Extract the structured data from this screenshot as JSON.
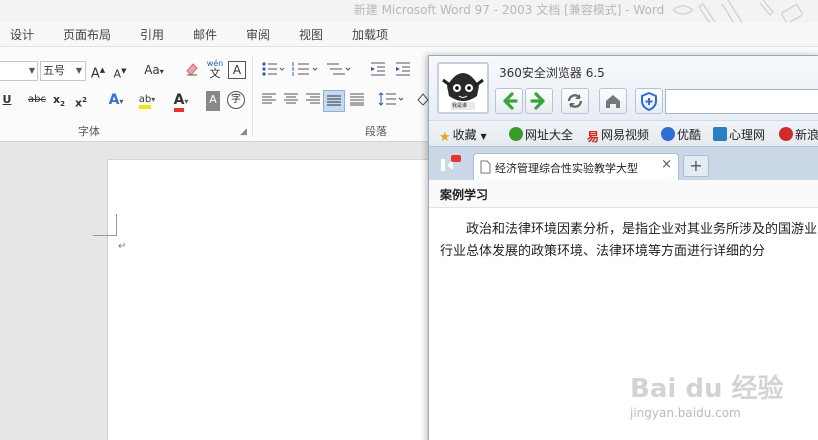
{
  "word": {
    "title": "新建 Microsoft Word 97 - 2003 文档 [兼容模式] - Word",
    "tabs": [
      "设计",
      "页面布局",
      "引用",
      "邮件",
      "审阅",
      "视图",
      "加载项"
    ],
    "font_size": "五号",
    "font_name": "",
    "ribbon_labels": {
      "grow": "A",
      "shrink": "A",
      "change_case": "Aa",
      "phonetic_top": "wén",
      "phonetic_bottom": "文",
      "border_char": "A",
      "strike": "abc",
      "subscript": "x",
      "subscript_small": "2",
      "superscript": "x",
      "superscript_small": "2",
      "underline": "U",
      "text_effect": "A",
      "highlight": "ab",
      "font_color": "A",
      "shade": "A",
      "enclose": "字"
    },
    "groups": {
      "font": "字体",
      "paragraph": "段落"
    },
    "paragraph_mark": "↵"
  },
  "browser": {
    "title": "360安全浏览器 6.5",
    "avatar_caption": "我是谁",
    "favorites": [
      {
        "label": "收藏",
        "color": "#e8a21a"
      },
      {
        "label": "网址大全",
        "color": "#3a9a2a"
      },
      {
        "label": "网易视频",
        "color": "#d0261c"
      },
      {
        "label": "优酷",
        "color": "#2c6fd1"
      },
      {
        "label": "心理网",
        "color": "#2a7fc4"
      },
      {
        "label": "新浪",
        "color": "#d12a2a"
      }
    ],
    "tab_label": "经济管理综合性实验教学大型",
    "tab_close": "×",
    "new_tab": "+",
    "section_title": "案例学习",
    "paragraph": "政治和法律环境因素分析，是指企业对其业务所涉及的国游业行业总体发展的政策环境、法律环境等方面进行详细的分"
  },
  "watermark": {
    "brand": "Bai du 经验",
    "url": "jingyan.baidu.com"
  },
  "colors": {
    "nav_green": "#3aa33a",
    "nav_blue": "#2c6fd1",
    "accent_red": "#e3342f",
    "highlight_yellow": "#f3e600"
  }
}
